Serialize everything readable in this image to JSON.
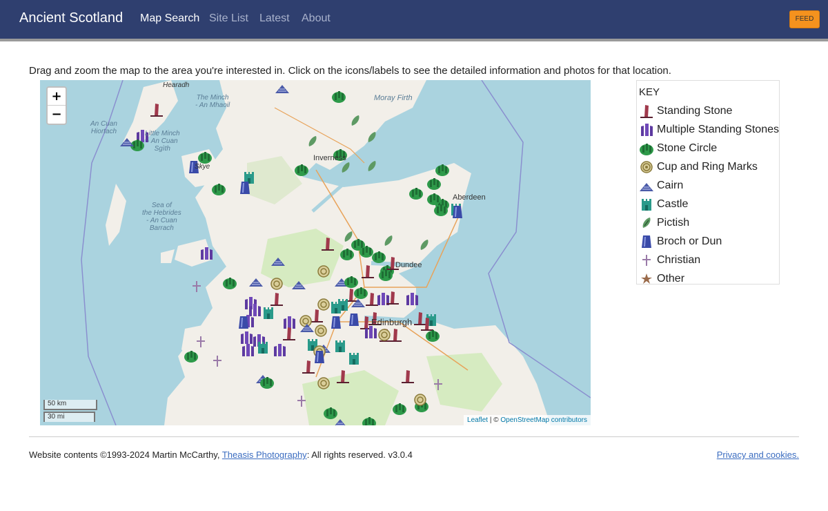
{
  "header": {
    "brand": "Ancient Scotland",
    "nav": [
      "Map Search",
      "Site List",
      "Latest",
      "About"
    ],
    "feed_label": "FEED"
  },
  "intro": "Drag and zoom the map to the area you're interested in. Click on the icons/labels to see the detailed information and photos for that location.",
  "map": {
    "zoom_in": "+",
    "zoom_out": "−",
    "scale_km": "50 km",
    "scale_mi": "30 mi",
    "attribution": {
      "leaflet": "Leaflet",
      "sep": " | © ",
      "osm": "OpenStreetMap contributors"
    },
    "water_labels": [
      "The Minch\n- An Mhaoil",
      "Moray Firth",
      "An Cuan\nHiortach",
      "Little Minch\n- An Cuan\nSgìth",
      "Sea of\nthe Hebrides\n- An Cuan\nBarrach"
    ],
    "places": [
      "Hearadh",
      "Inverness",
      "Aberdeen",
      "Dundee",
      "Edinburgh",
      "Skye"
    ],
    "colors": {
      "water": "#aad3df",
      "land": "#f2efe9",
      "green": "#d6ebc1"
    }
  },
  "key": {
    "title": "KEY",
    "items": [
      {
        "label": "Standing Stone",
        "icon": "standing-stone-icon"
      },
      {
        "label": "Multiple Standing Stones",
        "icon": "multiple-standing-stones-icon"
      },
      {
        "label": "Stone Circle",
        "icon": "stone-circle-icon"
      },
      {
        "label": "Cup and Ring Marks",
        "icon": "cup-and-ring-icon"
      },
      {
        "label": "Cairn",
        "icon": "cairn-icon"
      },
      {
        "label": "Castle",
        "icon": "castle-icon"
      },
      {
        "label": "Pictish",
        "icon": "pictish-icon"
      },
      {
        "label": "Broch or Dun",
        "icon": "broch-icon"
      },
      {
        "label": "Christian",
        "icon": "christian-icon"
      },
      {
        "label": "Other",
        "icon": "other-icon"
      }
    ]
  },
  "footer": {
    "copyright": "Website contents ©1993-2024 Martin McCarthy, ",
    "link": "Theasis Photography",
    "rights": ": All rights reserved. v3.0.4",
    "privacy": "Privacy and cookies."
  }
}
